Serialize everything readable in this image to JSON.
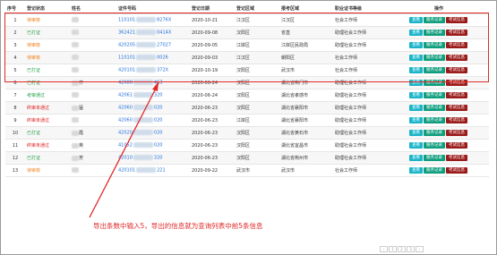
{
  "headers": [
    "序号",
    "登记状态",
    "姓名",
    "证件号码",
    "登记日期",
    "登记区域",
    "报考区域",
    "职业证书等级",
    "操作"
  ],
  "buttons": {
    "view": "查看",
    "service": "服务记录",
    "exam": "考试信息"
  },
  "rows": [
    {
      "num": "1",
      "status": "待审核",
      "status_color": "#f0821e",
      "name_suffix": "",
      "id_start": "110101",
      "id_end": "8276X",
      "date": "2020-10-21",
      "reg_area": "江汉区",
      "exam_area": "江汉区",
      "level": "社会工作师"
    },
    {
      "num": "2",
      "status": "已打证",
      "status_color": "#2aa34a",
      "name_suffix": "",
      "id_start": "362421",
      "id_end": "0414X",
      "date": "2020-09-08",
      "reg_area": "汉阳区",
      "exam_area": "省直",
      "level": "助理社会工作师"
    },
    {
      "num": "3",
      "status": "待审核",
      "status_color": "#f0821e",
      "name_suffix": "",
      "id_start": "420205",
      "id_end": "27027",
      "date": "2020-09-05",
      "reg_area": "江岸区",
      "exam_area": "江岸区民政局",
      "level": "助理社会工作师"
    },
    {
      "num": "4",
      "status": "待审核",
      "status_color": "#f0821e",
      "name_suffix": "",
      "id_start": "110101",
      "id_end": "0026",
      "date": "2020-09-03",
      "reg_area": "江汉区",
      "exam_area": "朝阳区",
      "level": "社会工作师"
    },
    {
      "num": "5",
      "status": "已打证",
      "status_color": "#2aa34a",
      "name_suffix": "",
      "id_start": "420101",
      "id_end": "372X",
      "date": "2020-10-19",
      "reg_area": "汉阳区",
      "exam_area": "武汉市",
      "level": "社会工作师"
    },
    {
      "num": "6",
      "status": "已打证",
      "status_color": "#2aa34a",
      "name_suffix": "齐",
      "id_start": "42088",
      "id_end": "463",
      "date": "2020-06-24",
      "reg_area": "汉阳区",
      "exam_area": "湖北省荆门市",
      "level": "助理社会工作师"
    },
    {
      "num": "7",
      "status": "考审通过",
      "status_color": "#2aa34a",
      "name_suffix": "",
      "id_start": "42061",
      "id_end": "320",
      "date": "2020-06-24",
      "reg_area": "汉阳区",
      "exam_area": "湖北省孝感市",
      "level": "助理社会工作师"
    },
    {
      "num": "8",
      "status": "终审未通过",
      "status_color": "#e02020",
      "name_suffix": "猛",
      "id_start": "42060",
      "id_end": "020",
      "date": "2020-06-23",
      "reg_area": "汉阳区",
      "exam_area": "湖北省襄阳市",
      "level": "助理社会工作师"
    },
    {
      "num": "9",
      "status": "终审未通过",
      "status_color": "#e02020",
      "name_suffix": "",
      "id_start": "42060",
      "id_end": "020",
      "date": "2020-06-23",
      "reg_area": "江岸区",
      "exam_area": "湖北省襄阳市",
      "level": "助理社会工作师"
    },
    {
      "num": "10",
      "status": "已打证",
      "status_color": "#2aa34a",
      "name_suffix": "霞",
      "id_start": "42020",
      "id_end": "020",
      "date": "2020-06-23",
      "reg_area": "汉阳区",
      "exam_area": "湖北省黄石市",
      "level": "助理社会工作师"
    },
    {
      "num": "11",
      "status": "终审未通过",
      "status_color": "#e02020",
      "name_suffix": "英",
      "id_start": "41052",
      "id_end": "020",
      "date": "2020-06-23",
      "reg_area": "汉阳区",
      "exam_area": "湖北省宜昌市",
      "level": "助理社会工作师"
    },
    {
      "num": "12",
      "status": "已打证",
      "status_color": "#2aa34a",
      "name_suffix": "芳",
      "id_start": "42010",
      "id_end": "320",
      "date": "2020-06-23",
      "reg_area": "汉阳区",
      "exam_area": "湖北省荆州市",
      "level": "助理社会工作师"
    },
    {
      "num": "13",
      "status": "待审核",
      "status_color": "#f0821e",
      "name_suffix": "",
      "id_start": "420101",
      "id_end": "221",
      "date": "2020-09-22",
      "reg_area": "武汉市",
      "exam_area": "武汉市",
      "level": "社会工作师"
    }
  ],
  "annotation": "导出条数中输入5，导出的信息就为查询列表中前5条信息"
}
